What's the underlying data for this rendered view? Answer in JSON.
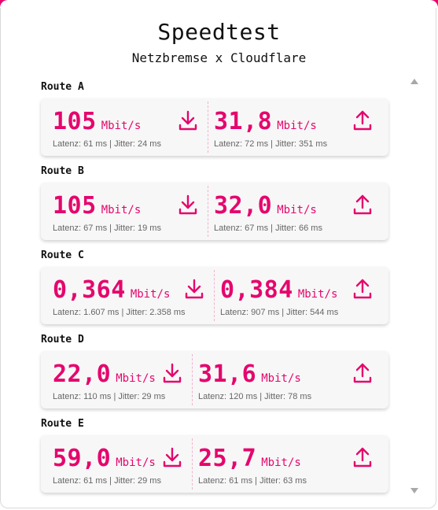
{
  "header": {
    "title": "Speedtest",
    "subtitle": "Netzbremse x Cloudflare"
  },
  "colors": {
    "accent": "#e5066d",
    "text": "#111111",
    "muted": "#666666",
    "card": "#f7f7f7"
  },
  "routes": [
    {
      "label": "Route A",
      "download": {
        "value": "105",
        "unit": "Mbit/s",
        "stats": "Latenz: 61 ms | Jitter: 24 ms",
        "icon": "download-icon"
      },
      "upload": {
        "value": "31,8",
        "unit": "Mbit/s",
        "stats": "Latenz: 72 ms | Jitter: 351 ms",
        "icon": "upload-icon"
      }
    },
    {
      "label": "Route B",
      "download": {
        "value": "105",
        "unit": "Mbit/s",
        "stats": "Latenz: 67 ms | Jitter: 19 ms",
        "icon": "download-icon"
      },
      "upload": {
        "value": "32,0",
        "unit": "Mbit/s",
        "stats": "Latenz: 67 ms | Jitter: 66 ms",
        "icon": "upload-icon"
      }
    },
    {
      "label": "Route C",
      "download": {
        "value": "0,364",
        "unit": "Mbit/s",
        "stats": "Latenz: 1.607 ms | Jitter: 2.358 ms",
        "icon": "download-icon"
      },
      "upload": {
        "value": "0,384",
        "unit": "Mbit/s",
        "stats": "Latenz: 907 ms | Jitter: 544 ms",
        "icon": "upload-icon"
      }
    },
    {
      "label": "Route D",
      "download": {
        "value": "22,0",
        "unit": "Mbit/s",
        "stats": "Latenz: 110 ms | Jitter: 29 ms",
        "icon": "download-icon"
      },
      "upload": {
        "value": "31,6",
        "unit": "Mbit/s",
        "stats": "Latenz: 120 ms | Jitter: 78 ms",
        "icon": "upload-icon"
      }
    },
    {
      "label": "Route E",
      "download": {
        "value": "59,0",
        "unit": "Mbit/s",
        "stats": "Latenz: 61 ms | Jitter: 29 ms",
        "icon": "download-icon"
      },
      "upload": {
        "value": "25,7",
        "unit": "Mbit/s",
        "stats": "Latenz: 61 ms | Jitter: 63 ms",
        "icon": "upload-icon"
      }
    }
  ]
}
